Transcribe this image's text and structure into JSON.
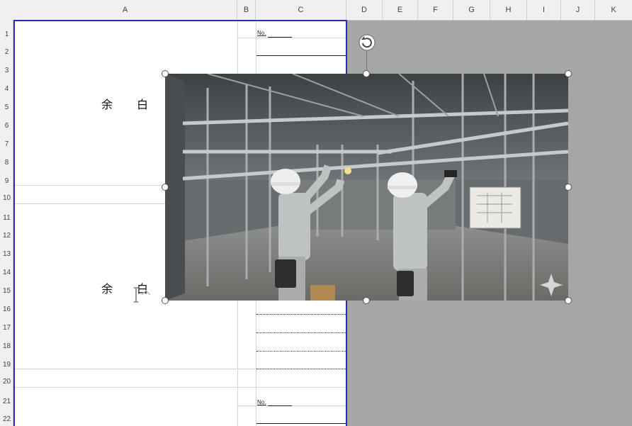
{
  "columns": [
    "A",
    "B",
    "C",
    "D",
    "E",
    "F",
    "G",
    "H",
    "I",
    "J",
    "K"
  ],
  "rows": [
    "1",
    "2",
    "3",
    "4",
    "5",
    "6",
    "7",
    "8",
    "9",
    "10",
    "11",
    "12",
    "13",
    "14",
    "15",
    "16",
    "17",
    "18",
    "19",
    "20",
    "21",
    "22"
  ],
  "cells": {
    "no_label_top": "No.",
    "no_label_bottom": "No.",
    "yohaku_top_1": "余",
    "yohaku_top_2": "白",
    "yohaku_bottom_1": "余",
    "yohaku_bottom_2": "白"
  },
  "image": {
    "subject": "construction-workers-installing-ceiling-frame-photo",
    "sparkle_icon": "sparkle-icon",
    "rotate_handle_icon": "rotate-icon"
  },
  "colors": {
    "page_break": "#2b2bb8",
    "background_gray": "#a6a6a6",
    "header_bg": "#f0f0f0"
  }
}
